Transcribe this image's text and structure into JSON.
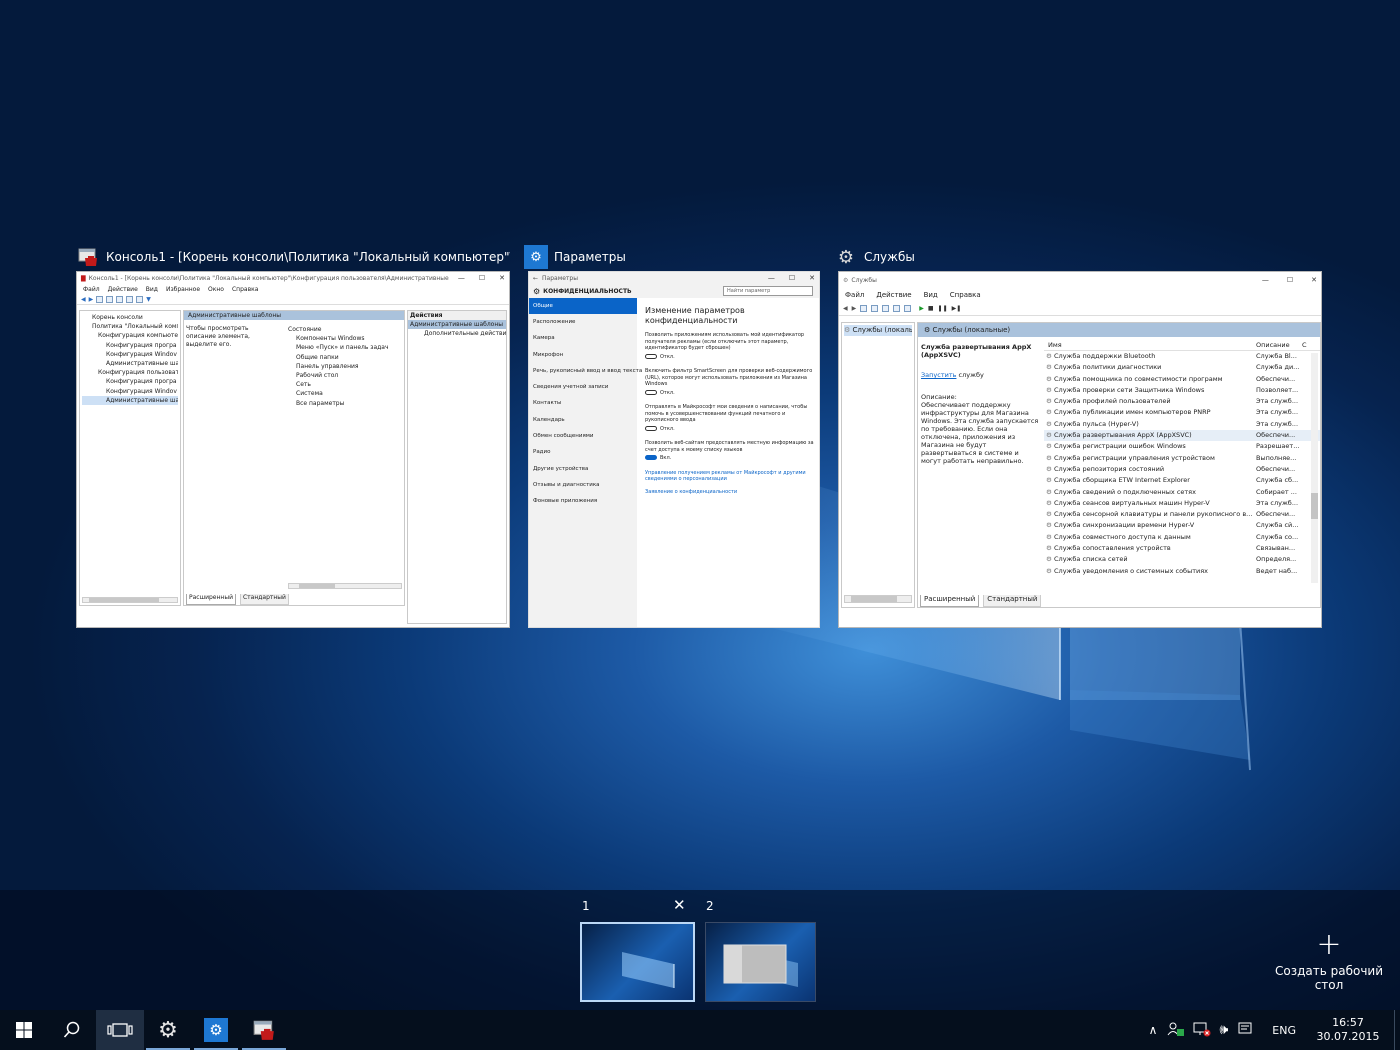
{
  "windows": [
    {
      "title": "Консоль1 - [Корень консоли\\Политика \"Локальный компьютер\"\\Ко...",
      "inner_title": "Консоль1 - [Корень консоли\\Политика \"Локальный компьютер\"\\Конфигурация пользователя\\Административные шаблоны]",
      "menu": [
        "Файл",
        "Действие",
        "Вид",
        "Избранное",
        "Окно",
        "Справка"
      ],
      "tree": [
        "Корень консоли",
        "Политика \"Локальный компь",
        "Конфигурация компьютер",
        "Конфигурация програ",
        "Конфигурация Windov",
        "Административные ша",
        "Конфигурация пользовате",
        "Конфигурация програ",
        "Конфигурация Windov",
        "Административные ша"
      ],
      "center_header": "Административные шаблоны",
      "center_desc": "Чтобы просмотреть описание элемента, выделите его.",
      "list_header": "Состояние",
      "list": [
        "Компоненты Windows",
        "Меню «Пуск» и панель задач",
        "Общие папки",
        "Панель управления",
        "Рабочий стол",
        "Сеть",
        "Система",
        "Все параметры"
      ],
      "actions_header": "Действия",
      "actions": [
        "Административные шаблоны",
        "Дополнительные действия"
      ],
      "tabs": [
        "Расширенный",
        "Стандартный"
      ]
    },
    {
      "title": "Параметры",
      "inner_title": "Параметры",
      "section": "КОНФИДЕНЦИАЛЬНОСТЬ",
      "search_placeholder": "Найти параметр",
      "nav": [
        "Общие",
        "Расположение",
        "Камера",
        "Микрофон",
        "Речь, рукописный ввод и ввод текста",
        "Сведения учетной записи",
        "Контакты",
        "Календарь",
        "Обмен сообщениями",
        "Радио",
        "Другие устройства",
        "Отзывы и диагностика",
        "Фоновые приложения"
      ],
      "heading": "Изменение параметров конфиденциальности",
      "settings": [
        {
          "text": "Позволить приложениям использовать мой идентификатор получателя рекламы (если отключить этот параметр, идентификатор будет сброшен)",
          "state": "Откл."
        },
        {
          "text": "Включить фильтр SmartScreen для проверки веб-содержимого (URL), которое могут использовать приложения из Магазина Windows",
          "state": "Откл."
        },
        {
          "text": "Отправлять в Майкрософт мои сведения о написании, чтобы помочь в усовершенствовании функций печатного и рукописного ввода",
          "state": "Откл."
        },
        {
          "text": "Позволить веб-сайтам предоставлять местную информацию за счет доступа к моему списку языков",
          "state": "Вкл."
        }
      ],
      "links": [
        "Управление получением рекламы от Майкрософт и другими сведениями о персонализации",
        "Заявление о конфиденциальности"
      ]
    },
    {
      "title": "Службы",
      "inner_title": "Службы",
      "menu": [
        "Файл",
        "Действие",
        "Вид",
        "Справка"
      ],
      "tree": [
        "Службы (локальн"
      ],
      "header": "Службы (локальные)",
      "service_name": "Служба развертывания AppX (AppXSVC)",
      "start_link": "Запустить",
      "start_suffix": " службу",
      "desc_label": "Описание:",
      "desc": "Обеспечивает поддержку инфраструктуры для Магазина Windows. Эта служба запускается по требованию. Если она отключена, приложения из Магазина не будут развертываться в системе и могут работать неправильно.",
      "col_name": "Имя",
      "col_desc": "Описание",
      "col_state": "С",
      "rows": [
        {
          "name": "Служба поддержки Bluetooth",
          "desc": "Служба Bl..."
        },
        {
          "name": "Служба политики диагностики",
          "desc": "Служба ди..."
        },
        {
          "name": "Служба помощника по совместимости программ",
          "desc": "Обеспечи..."
        },
        {
          "name": "Служба проверки сети Защитника Windows",
          "desc": "Позволяет..."
        },
        {
          "name": "Служба профилей пользователей",
          "desc": "Эта служб..."
        },
        {
          "name": "Служба публикации имен компьютеров PNRP",
          "desc": "Эта служб..."
        },
        {
          "name": "Служба пульса (Hyper-V)",
          "desc": "Эта служб..."
        },
        {
          "name": "Служба развертывания AppX (AppXSVC)",
          "desc": "Обеспечи..."
        },
        {
          "name": "Служба регистрации ошибок Windows",
          "desc": "Разрешает..."
        },
        {
          "name": "Служба регистрации управления устройством",
          "desc": "Выполняе..."
        },
        {
          "name": "Служба репозитория состояний",
          "desc": "Обеспечи..."
        },
        {
          "name": "Служба сборщика ETW Internet Explorer",
          "desc": "Служба сб..."
        },
        {
          "name": "Служба сведений о подключенных сетях",
          "desc": "Собирает ..."
        },
        {
          "name": "Служба сеансов виртуальных машин Hyper-V",
          "desc": "Эта служб..."
        },
        {
          "name": "Служба сенсорной клавиатуры и панели рукописного в...",
          "desc": "Обеспечи..."
        },
        {
          "name": "Служба синхронизации времени Hyper-V",
          "desc": "Служба сй..."
        },
        {
          "name": "Служба совместного доступа к данным",
          "desc": "Служба со..."
        },
        {
          "name": "Служба сопоставления устройств",
          "desc": "Связыван..."
        },
        {
          "name": "Служба списка сетей",
          "desc": "Определя..."
        },
        {
          "name": "Служба уведомления о системных событиях",
          "desc": "Ведет наб..."
        }
      ],
      "tabs": [
        "Расширенный",
        "Стандартный"
      ]
    }
  ],
  "desktops": {
    "items": [
      {
        "label": "1"
      },
      {
        "label": "2"
      }
    ],
    "close_glyph": "✕",
    "new_desktop_label": "Создать рабочий стол"
  },
  "taskbar": {
    "lang": "ENG",
    "time": "16:57",
    "date": "30.07.2015"
  },
  "icons": {
    "start": "windows-logo-icon",
    "search": "search-icon",
    "task_view": "task-view-icon",
    "settings": "gear-icon",
    "console": "mmc-console-icon"
  },
  "colors": {
    "accent": "#0a64c8",
    "settings_tile": "#1e78d2",
    "taskbar": "#050f1d"
  }
}
